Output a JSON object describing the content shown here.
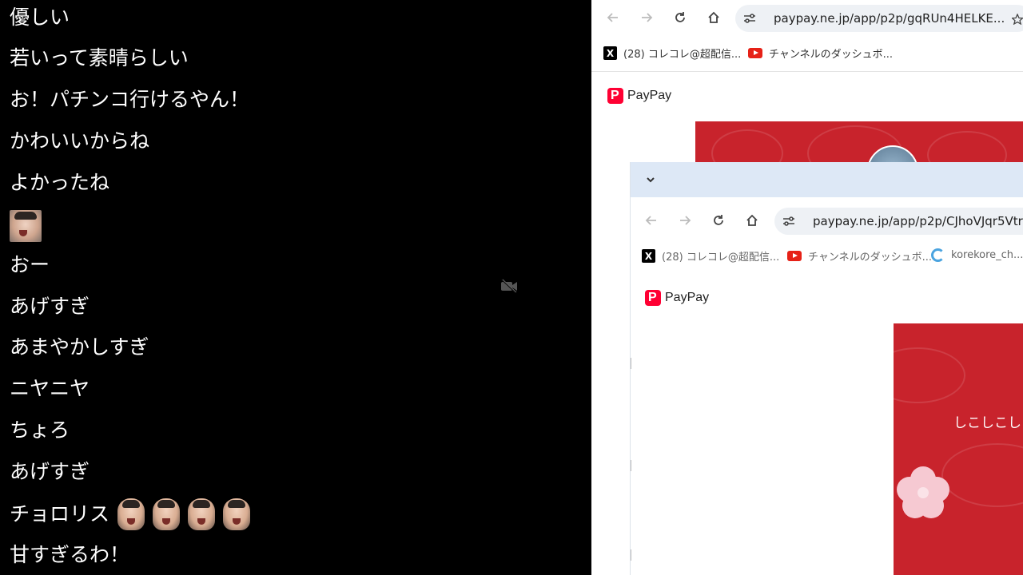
{
  "chat": {
    "messages": [
      "優しい",
      "若いって素晴らしい",
      "お！パチンコ行けるやん！",
      "かわいいからね",
      "よかったね",
      "",
      "おー",
      "あげすぎ",
      "あまやかしすぎ",
      "ニヤニヤ",
      "ちょろ",
      "あげすぎ",
      "チョロリス",
      "甘すぎるわ！"
    ]
  },
  "browser": {
    "address": "paypay.ne.jp/app/p2p/gqRUn4HELKE...",
    "bookmarks": [
      "(28) コレコレ@超配信...",
      "チャンネルのダッシュボ..."
    ],
    "logo_text": "PayPay",
    "inner": {
      "address": "paypay.ne.jp/app/p2p/CJhoVJqr5Vtr",
      "bookmarks": [
        "(28) コレコレ@超配信...",
        "チャンネルのダッシュボ...",
        "korekore_ch..."
      ],
      "logo_text": "PayPay",
      "card_text": "しこしこし"
    }
  },
  "colors": {
    "accent_red": "#c8232c",
    "paypay_red": "#ff0033",
    "tabbar": "#dde8f6"
  },
  "icons": [
    "back-icon",
    "forward-icon",
    "reload-icon",
    "home-icon",
    "tune-icon",
    "star-icon",
    "x-icon",
    "youtube-icon",
    "chevron-down-icon",
    "camera-off-icon"
  ]
}
